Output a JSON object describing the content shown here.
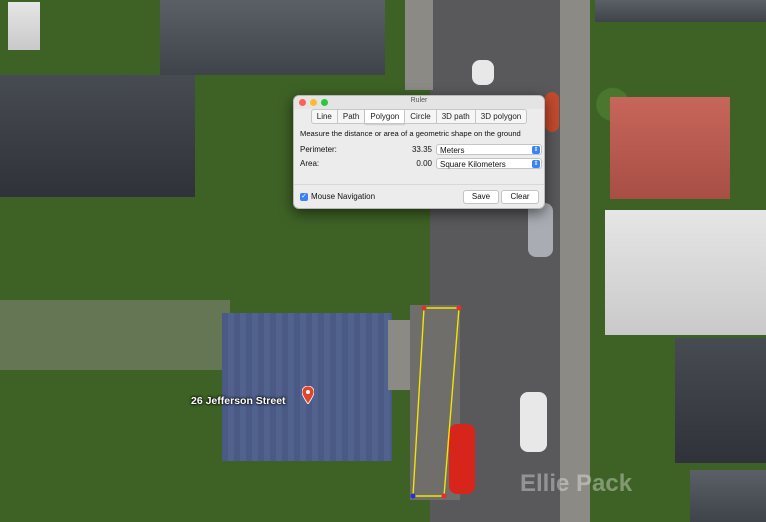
{
  "ruler": {
    "window_title": "Ruler",
    "tabs": [
      {
        "label": "Line"
      },
      {
        "label": "Path"
      },
      {
        "label": "Polygon"
      },
      {
        "label": "Circle"
      },
      {
        "label": "3D path"
      },
      {
        "label": "3D polygon"
      }
    ],
    "active_tab": "Polygon",
    "description": "Measure the distance or area of a geometric shape on the ground",
    "perimeter": {
      "label": "Perimeter:",
      "value": "33.35",
      "unit": "Meters"
    },
    "area": {
      "label": "Area:",
      "value": "0.00",
      "unit": "Square Kilometers"
    },
    "mouse_navigation": {
      "label": "Mouse Navigation",
      "checked": true
    },
    "save_label": "Save",
    "clear_label": "Clear"
  },
  "map": {
    "placemark_label": "26 Jefferson Street",
    "polygon_color": "#f2e600",
    "watermark": "Ellie Pack"
  },
  "colors": {
    "accent": "#3b82f6",
    "placemark": "#e0442b"
  }
}
